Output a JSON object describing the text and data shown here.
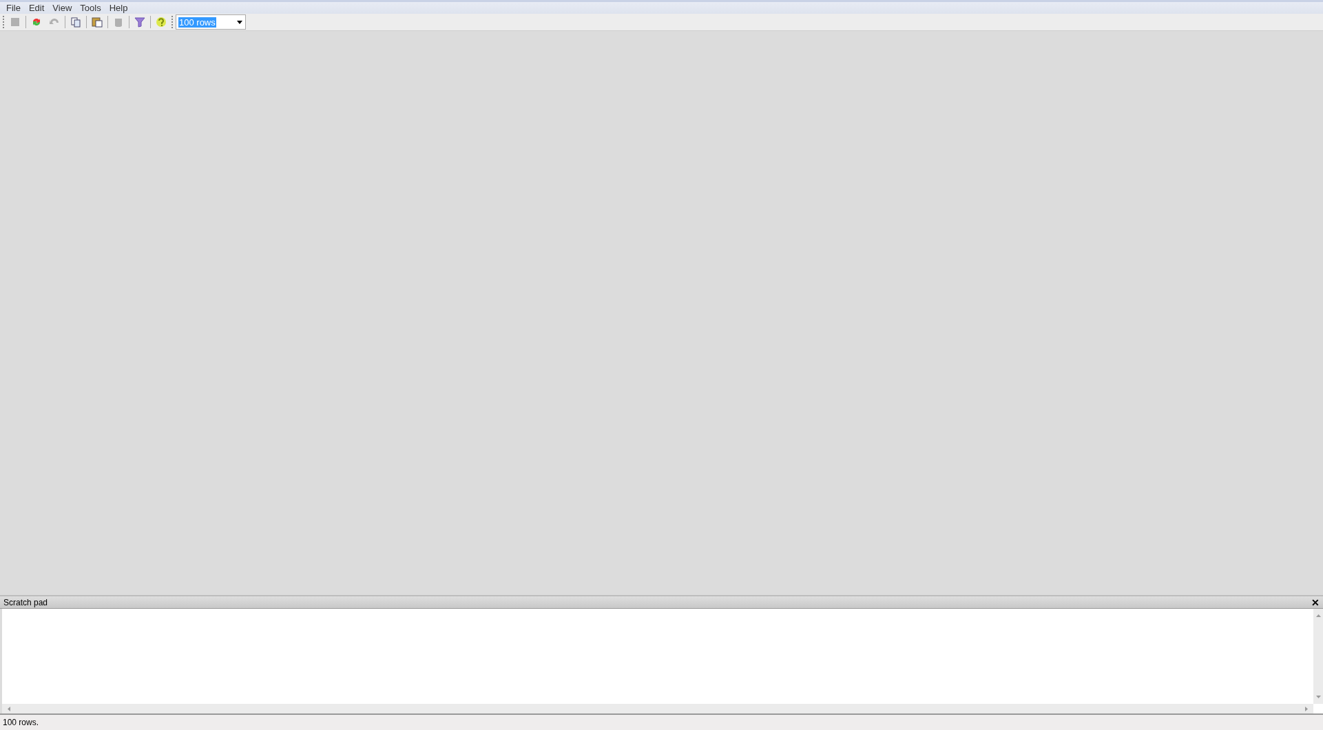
{
  "menu": [
    "File",
    "Edit",
    "View",
    "Tools",
    "Help"
  ],
  "toolbar": [
    {
      "kind": "stop",
      "disabled": true
    },
    {
      "kind": "sep"
    },
    {
      "kind": "refresh",
      "disabled": false
    },
    {
      "kind": "undo",
      "disabled": true
    },
    {
      "kind": "sep"
    },
    {
      "kind": "copy",
      "disabled": false
    },
    {
      "kind": "sep"
    },
    {
      "kind": "paste",
      "disabled": false
    },
    {
      "kind": "sep"
    },
    {
      "kind": "database",
      "disabled": true
    },
    {
      "kind": "sep"
    },
    {
      "kind": "filter",
      "disabled": false
    },
    {
      "kind": "sep"
    },
    {
      "kind": "help",
      "disabled": false
    }
  ],
  "row_limit": {
    "value": "100 rows"
  },
  "scratch_pad": {
    "title": "Scratch pad",
    "close": "✕"
  },
  "status_bar": "100 rows."
}
